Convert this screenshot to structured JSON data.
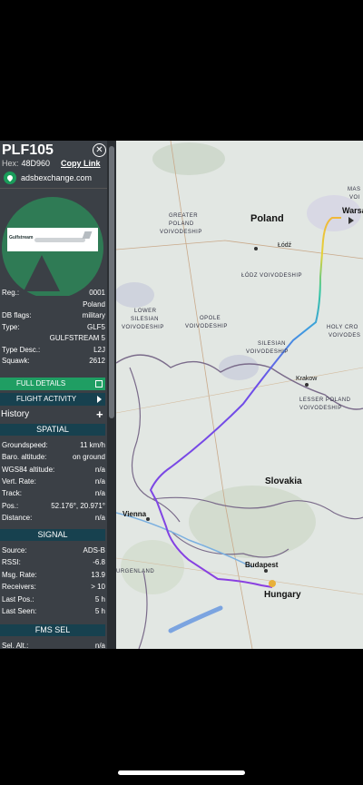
{
  "aircraft": {
    "callsign": "PLF105",
    "hex_label": "Hex:",
    "hex_value": "48D960",
    "copy_link": "Copy Link",
    "source_site": "adsbexchange.com",
    "photo_brand": "Gulfstream"
  },
  "details": [
    {
      "k": "Reg.:",
      "v": "0001"
    },
    {
      "k": "",
      "v": "Poland"
    },
    {
      "k": "DB flags:",
      "v": "military"
    },
    {
      "k": "Type:",
      "v": "GLF5"
    },
    {
      "k": "",
      "v": "GULFSTREAM 5"
    },
    {
      "k": "Type Desc.:",
      "v": "L2J"
    },
    {
      "k": "Squawk:",
      "v": "2612"
    }
  ],
  "buttons": {
    "full_details": "FULL DETAILS",
    "flight_activity": "FLIGHT ACTIVITY"
  },
  "history": {
    "label": "History",
    "plus": "+"
  },
  "spatial": {
    "header": "SPATIAL",
    "rows": [
      {
        "k": "Groundspeed:",
        "v": "11 km/h"
      },
      {
        "k": "Baro. altitude:",
        "v": "on ground"
      },
      {
        "k": "WGS84 altitude:",
        "v": "n/a"
      },
      {
        "k": "Vert. Rate:",
        "v": "n/a"
      },
      {
        "k": "Track:",
        "v": "n/a"
      },
      {
        "k": "Pos.:",
        "v": "52.176°, 20.971°"
      },
      {
        "k": "Distance:",
        "v": "n/a"
      }
    ]
  },
  "signal": {
    "header": "SIGNAL",
    "rows": [
      {
        "k": "Source:",
        "v": "ADS-B"
      },
      {
        "k": "RSSI:",
        "v": "-6.8"
      },
      {
        "k": "Msg. Rate:",
        "v": "13.9"
      },
      {
        "k": "Receivers:",
        "v": "> 10"
      },
      {
        "k": "Last Pos.:",
        "v": "5 h"
      },
      {
        "k": "Last Seen:",
        "v": "5 h"
      }
    ]
  },
  "fms": {
    "header": "FMS SEL",
    "rows": [
      {
        "k": "Sel. Alt.:",
        "v": "n/a"
      }
    ]
  },
  "map": {
    "cities": [
      "Poland",
      "Warsa",
      "Łódź",
      "Krakow",
      "Slovakia",
      "Vienna",
      "Budapest",
      "Hungary"
    ],
    "regions": [
      "GREATER",
      "POLAND",
      "VOIVODESHIP",
      "ŁÓDZ VOIVODESHIP",
      "LOWER",
      "SILESIAN",
      "VOIVODESHIP",
      "OPOLE",
      "VOIVODESHIP",
      "HOLY CRO",
      "VOIVODES",
      "SILESIAN",
      "VOIVODESHIP",
      "LESSER POLAND",
      "VOIVODESHIP",
      "MAS",
      "VOI",
      "URGENLAND"
    ],
    "colors": {
      "track_purple": "#8a3fe0",
      "track_teal": "#2fb3a8",
      "track_yellow": "#e3d23a",
      "land": "#e2e7e3",
      "border": "#7a6b8a"
    }
  }
}
